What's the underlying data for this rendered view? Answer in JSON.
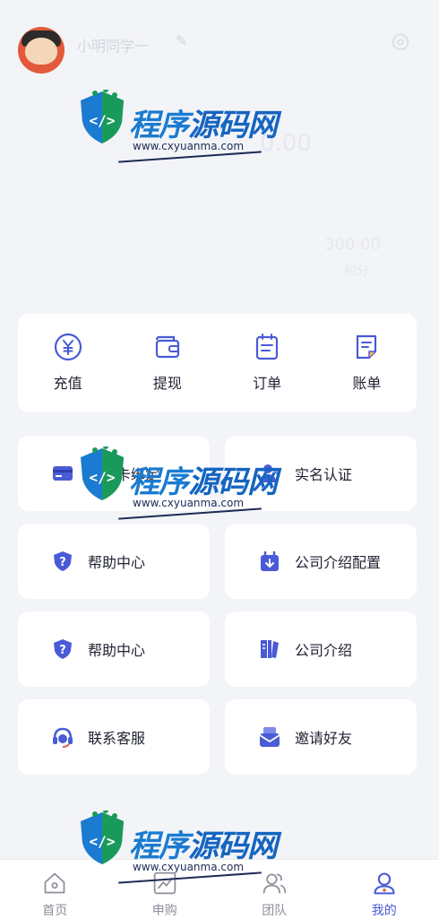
{
  "profile": {
    "username": "小明同学一"
  },
  "header": {
    "balance": "0.00",
    "stat_value": "300.00",
    "stat_label": "积分"
  },
  "watermark": {
    "title_part1": "程序",
    "title_part2": "源码网",
    "url": "www.cxyuanma.com"
  },
  "quick_actions": [
    {
      "label": "充值",
      "icon": "yuan-coin-icon"
    },
    {
      "label": "提现",
      "icon": "wallet-icon"
    },
    {
      "label": "订单",
      "icon": "order-list-icon"
    },
    {
      "label": "账单",
      "icon": "bill-icon"
    }
  ],
  "tiles": [
    {
      "label": "银行卡绑定",
      "icon": "bank-card-icon"
    },
    {
      "label": "实名认证",
      "icon": "user-verify-icon"
    },
    {
      "label": "帮助中心",
      "icon": "help-icon"
    },
    {
      "label": "公司介绍配置",
      "icon": "company-config-icon"
    },
    {
      "label": "帮助中心",
      "icon": "help-icon"
    },
    {
      "label": "公司介绍",
      "icon": "company-book-icon"
    },
    {
      "label": "联系客服",
      "icon": "headset-icon"
    },
    {
      "label": "邀请好友",
      "icon": "invite-mail-icon"
    }
  ],
  "tabbar": [
    {
      "label": "首页",
      "icon": "home-icon",
      "active": false
    },
    {
      "label": "申购",
      "icon": "trend-chart-icon",
      "active": false
    },
    {
      "label": "团队",
      "icon": "team-icon",
      "active": false
    },
    {
      "label": "我的",
      "icon": "profile-icon",
      "active": true
    }
  ],
  "colors": {
    "accent": "#4a5bd6",
    "background": "#f3f4f8",
    "card": "#ffffff"
  }
}
